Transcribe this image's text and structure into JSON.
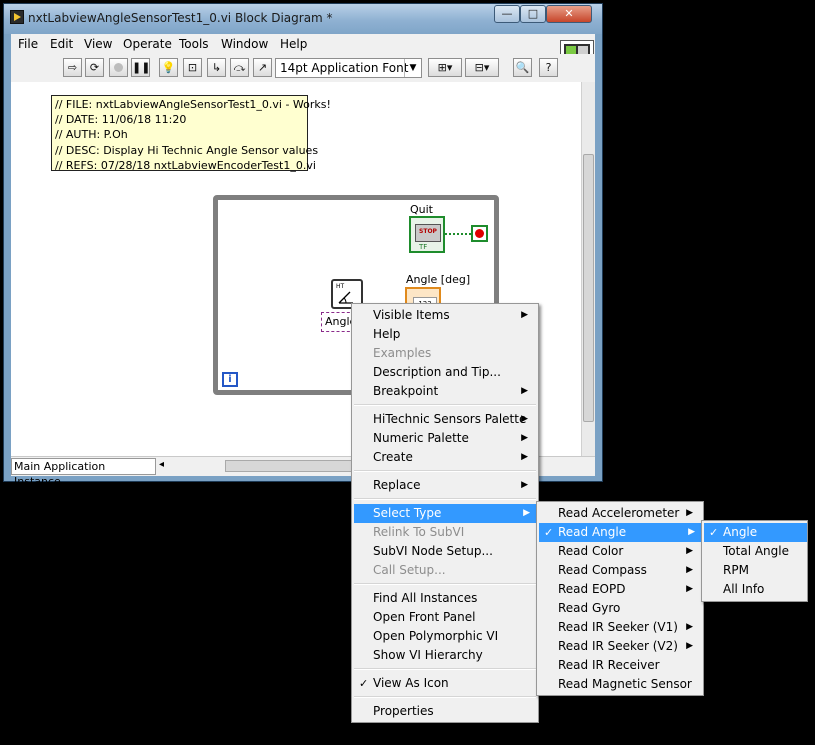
{
  "window": {
    "title": "nxtLabviewAngleSensorTest1_0.vi Block Diagram *",
    "caption_buttons": {
      "minimize": "—",
      "maximize": "□",
      "close": "✕"
    }
  },
  "menubar": {
    "items": [
      "File",
      "Edit",
      "View",
      "Operate",
      "Tools",
      "Window",
      "Help"
    ]
  },
  "toolbar": {
    "font": "14pt Application Font",
    "buttons": [
      "run-arrow-icon",
      "run-continuous-icon",
      "abort-icon",
      "pause-icon",
      "highlight-execution-icon",
      "retain-wire-values-icon",
      "step-into-icon",
      "step-over-icon",
      "step-out-icon",
      "align-objects-icon",
      "distribute-objects-icon",
      "reorder-icon",
      "search-icon",
      "help-icon"
    ]
  },
  "diagram": {
    "comment_lines": [
      "// FILE: nxtLabviewAngleSensorTest1_0.vi - Works!",
      "// DATE: 11/06/18 11:20",
      "// AUTH: P.Oh",
      "// DESC: Display Hi Technic Angle Sensor values",
      "// REFS: 07/28/18 nxtLabviewEncoderTest1_0.vi"
    ],
    "quit_label": "Quit",
    "stop_text": "STOP",
    "tf_text": "TF",
    "angle_label": "Angle [deg]",
    "angle_indicator": "123",
    "polysel_text": "Angle",
    "iteration_label": "i"
  },
  "statusbar": {
    "instance": "Main Application Instance"
  },
  "context_menu": {
    "items": [
      {
        "label": "Visible Items",
        "submenu": true
      },
      {
        "label": "Help"
      },
      {
        "label": "Examples",
        "disabled": true
      },
      {
        "label": "Description and Tip..."
      },
      {
        "label": "Breakpoint",
        "submenu": true
      },
      {
        "label": "HiTechnic Sensors Palette",
        "submenu": true
      },
      {
        "label": "Numeric Palette",
        "submenu": true
      },
      {
        "label": "Create",
        "submenu": true
      },
      {
        "label": "Replace",
        "submenu": true
      },
      {
        "label": "Select Type",
        "submenu": true,
        "highlighted": true
      },
      {
        "label": "Relink To SubVI",
        "disabled": true
      },
      {
        "label": "SubVI Node Setup..."
      },
      {
        "label": "Call Setup...",
        "disabled": true
      },
      {
        "label": "Find All Instances"
      },
      {
        "label": "Open Front Panel"
      },
      {
        "label": "Open Polymorphic VI"
      },
      {
        "label": "Show VI Hierarchy"
      },
      {
        "label": "View As Icon",
        "checked": true
      },
      {
        "label": "Properties"
      }
    ]
  },
  "select_type_menu": {
    "items": [
      {
        "label": "Read Accelerometer",
        "submenu": true
      },
      {
        "label": "Read Angle",
        "submenu": true,
        "checked": true,
        "highlighted": true
      },
      {
        "label": "Read Color",
        "submenu": true
      },
      {
        "label": "Read Compass",
        "submenu": true
      },
      {
        "label": "Read EOPD",
        "submenu": true
      },
      {
        "label": "Read Gyro"
      },
      {
        "label": "Read IR Seeker (V1)",
        "submenu": true
      },
      {
        "label": "Read IR Seeker (V2)",
        "submenu": true
      },
      {
        "label": "Read IR Receiver"
      },
      {
        "label": "Read Magnetic Sensor"
      }
    ]
  },
  "read_angle_menu": {
    "items": [
      {
        "label": "Angle",
        "checked": true,
        "highlighted": true
      },
      {
        "label": "Total Angle"
      },
      {
        "label": "RPM"
      },
      {
        "label": "All Info"
      }
    ]
  },
  "colors": {
    "highlight": "#3399ff",
    "menu_bg": "#f0f0f0",
    "comment_bg": "#ffffd0",
    "loop_border": "#7f7f7f"
  }
}
